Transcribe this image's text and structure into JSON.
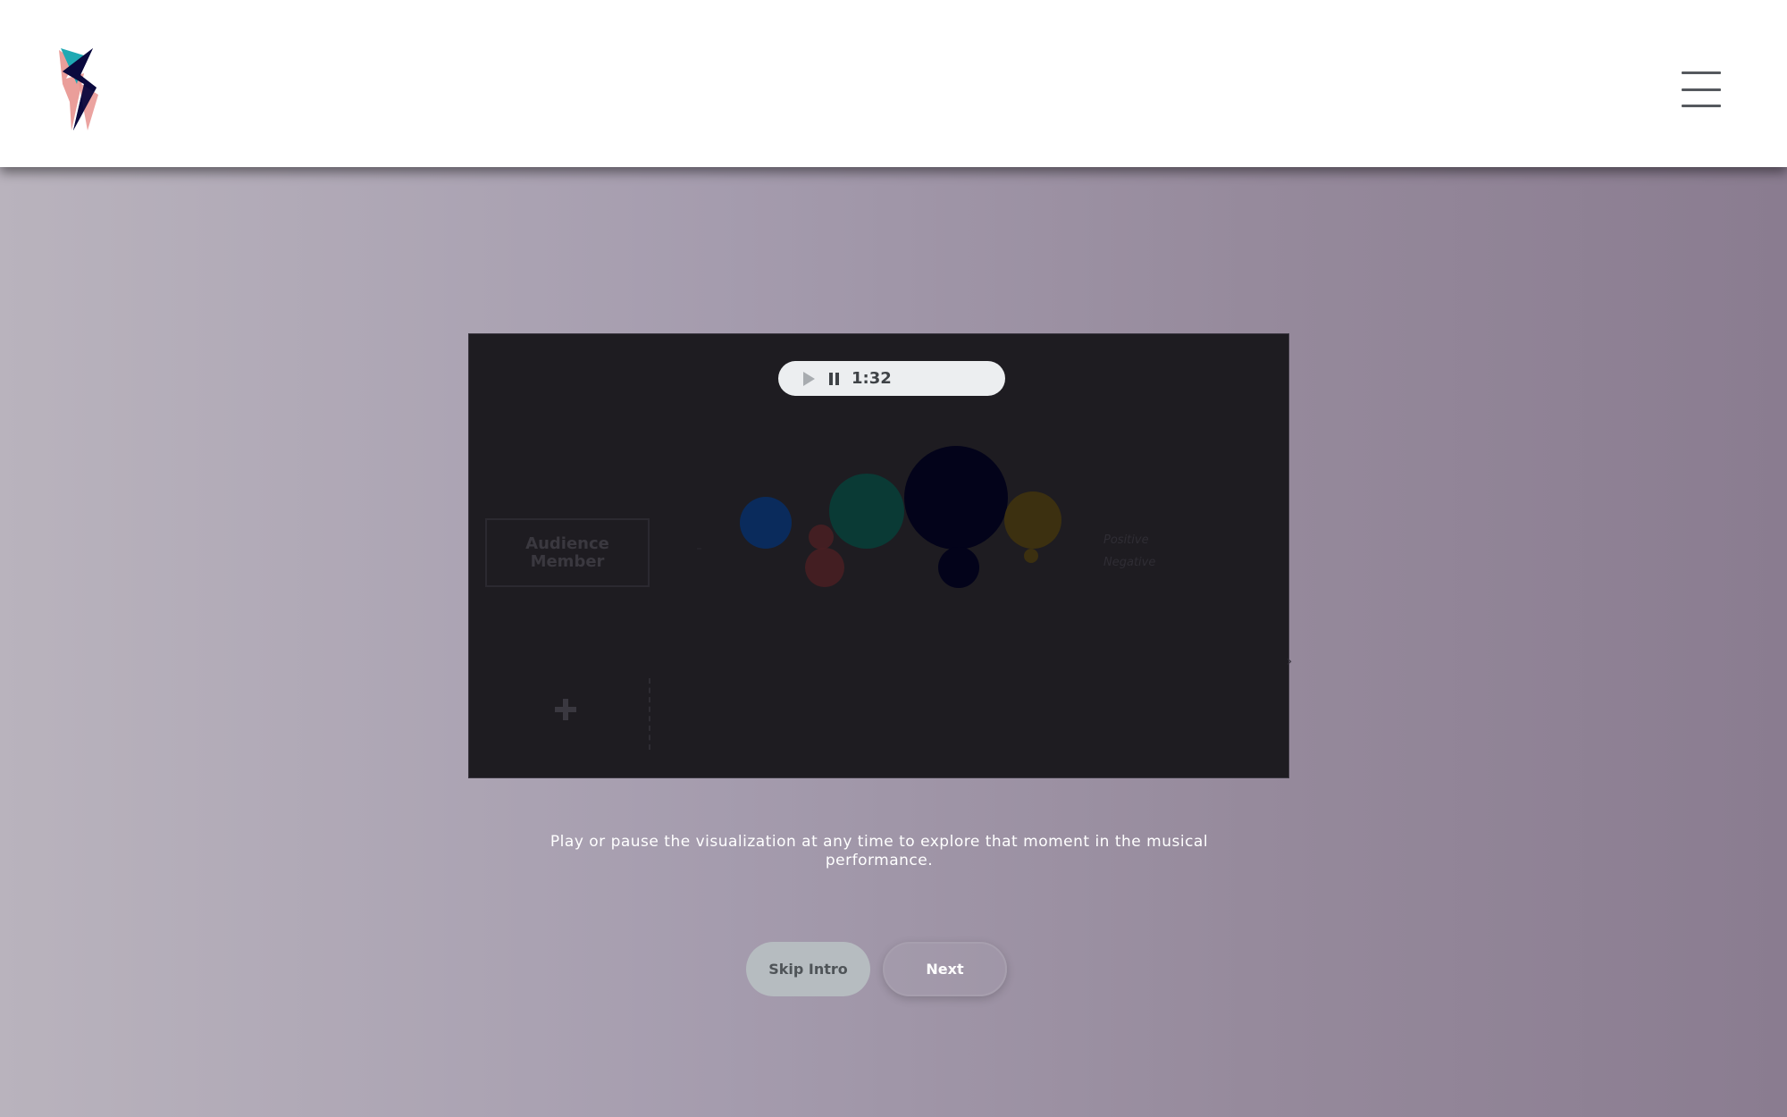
{
  "header": {
    "logo_icon": "lightning-bolt-logo",
    "menu_icon": "hamburger-menu-icon",
    "logo_colors": [
      "#0b0a3e",
      "#1fa9b3",
      "#e8938f"
    ]
  },
  "player": {
    "play_icon": "play-icon",
    "pause_icon": "pause-icon",
    "time": "1:32"
  },
  "visualization": {
    "audience_label": "Audience Member",
    "legend": {
      "positive": "Positive",
      "negative": "Negative"
    },
    "bubbles": [
      {
        "color": "#0a2b5c"
      },
      {
        "color": "#4a1e22"
      },
      {
        "color": "#0a3a35"
      },
      {
        "color": "#03031a"
      },
      {
        "color": "#3c3010"
      }
    ]
  },
  "caption": "Play or pause the visualization at any time to explore that moment in the musical performance.",
  "buttons": {
    "skip_label": "Skip Intro",
    "next_label": "Next"
  }
}
